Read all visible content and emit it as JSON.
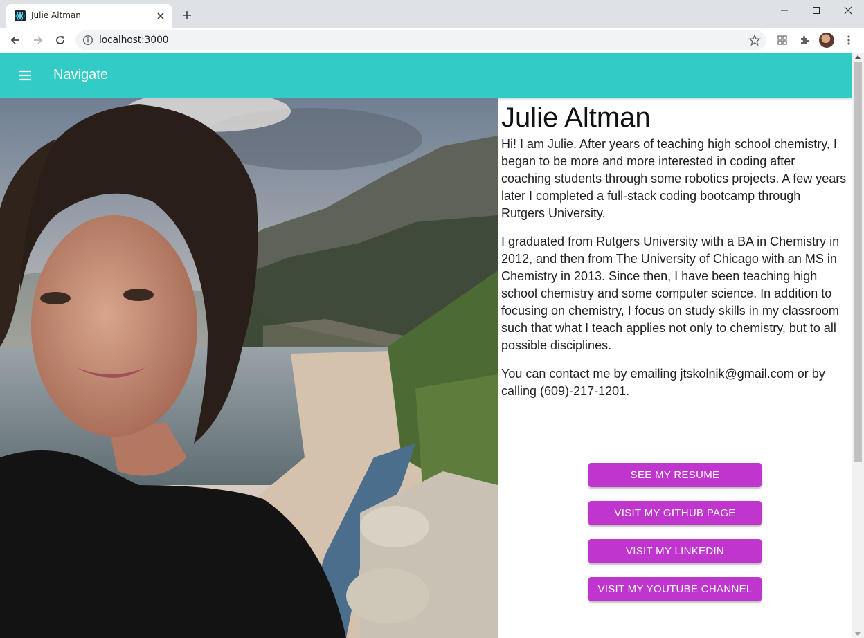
{
  "browser": {
    "tab_title": "Julie Altman",
    "url": "localhost:3000"
  },
  "appbar": {
    "title": "Navigate"
  },
  "profile": {
    "name": "Julie Altman",
    "paragraphs": [
      "Hi! I am Julie. After years of teaching high school chemistry, I began to be more and more interested in coding after coaching students through some robotics projects. A few years later I completed a full-stack coding bootcamp through Rutgers University.",
      "I graduated from Rutgers University with a BA in Chemistry in 2012, and then from The University of Chicago with an MS in Chemistry in 2013. Since then, I have been teaching high school chemistry and some computer science. In addition to focusing on chemistry, I focus on study skills in my classroom such that what I teach applies not only to chemistry, but to all possible disciplines.",
      "You can contact me by emailing jtskolnik@gmail.com or by calling (609)-217-1201."
    ]
  },
  "buttons": {
    "resume": "SEE MY RESUME",
    "github": "VISIT MY GITHUB PAGE",
    "linkedin": "VISIT MY LINKEDIN",
    "youtube": "VISIT MY YOUTUBE CHANNEL"
  },
  "colors": {
    "appbar": "#33cbc5",
    "button": "#c135cf"
  },
  "icons": {
    "favicon": "react-icon",
    "menu": "menu-icon"
  }
}
